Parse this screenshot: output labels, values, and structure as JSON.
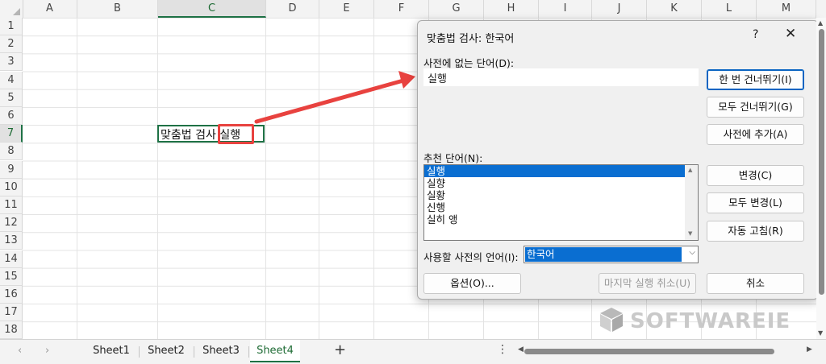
{
  "spreadsheet": {
    "columns": [
      "A",
      "B",
      "C",
      "D",
      "E",
      "F",
      "G",
      "H",
      "I",
      "J",
      "K",
      "L",
      "M"
    ],
    "rows": [
      "1",
      "2",
      "3",
      "4",
      "5",
      "6",
      "7",
      "8",
      "9",
      "10",
      "11",
      "12",
      "13",
      "14",
      "15",
      "16",
      "17",
      "18"
    ],
    "cell_C7_prefix": "맞춤법 검사",
    "cell_C7_word": "실행"
  },
  "dialog": {
    "title": "맞춤법 검사: 한국어",
    "help": "?",
    "close": "✕",
    "not_in_dict_label": "사전에 없는 단어(D):",
    "not_in_dict_value": "실행",
    "suggestions_label": "추천 단어(N):",
    "suggestions": [
      "실행",
      "실향",
      "실황",
      "신행",
      "실히 앵"
    ],
    "language_label": "사용할 사전의 언어(I):",
    "language_value": "한국어",
    "buttons": {
      "ignore_once": "한 번 건너뛰기(I)",
      "ignore_all": "모두 건너뛰기(G)",
      "add_to_dict": "사전에 추가(A)",
      "change": "변경(C)",
      "change_all": "모두 변경(L)",
      "autocorrect": "자동 고침(R)",
      "options": "옵션(O)...",
      "undo_last": "마지막 실행 취소(U)",
      "cancel": "취소"
    }
  },
  "sheets": {
    "tabs": [
      "Sheet1",
      "Sheet2",
      "Sheet3",
      "Sheet4"
    ],
    "active": "Sheet4",
    "add": "+",
    "more": "⋮"
  },
  "watermark": "SOFTWAREIE",
  "colors": {
    "accent": "#1e7145",
    "highlight": "#e8423f",
    "selection": "#0a6ed1"
  }
}
